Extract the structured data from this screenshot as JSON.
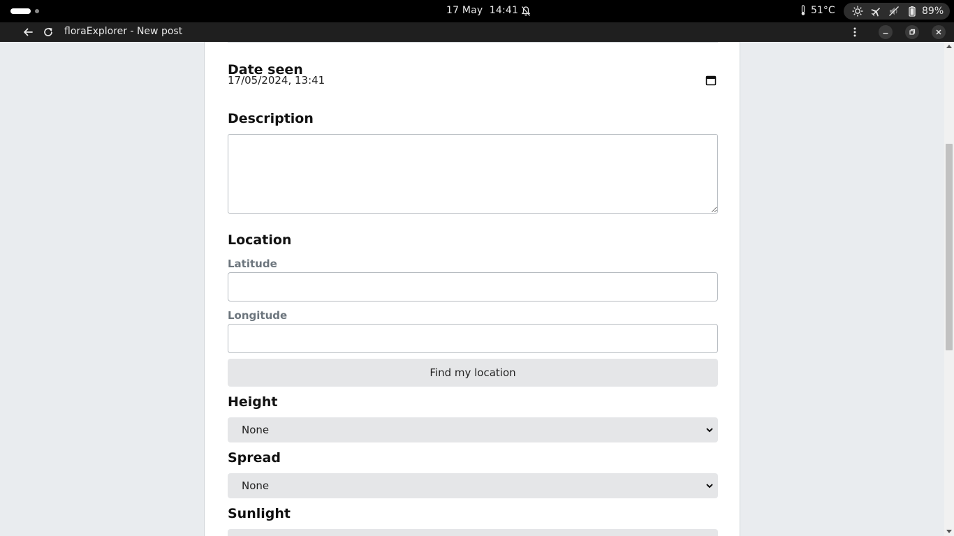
{
  "system_bar": {
    "date": "17 May",
    "time": "14:41",
    "temperature": "51°C",
    "battery": "89%"
  },
  "app_window": {
    "title": "floraExplorer - New post"
  },
  "form": {
    "date_seen": {
      "heading": "Date seen",
      "value": "17/05/2024, 13:41"
    },
    "description": {
      "heading": "Description",
      "value": ""
    },
    "location": {
      "heading": "Location",
      "latitude_label": "Latitude",
      "latitude_value": "",
      "longitude_label": "Longitude",
      "longitude_value": "",
      "find_button": "Find my location"
    },
    "height": {
      "heading": "Height",
      "selected": "None"
    },
    "spread": {
      "heading": "Spread",
      "selected": "None"
    },
    "sunlight": {
      "heading": "Sunlight"
    }
  }
}
